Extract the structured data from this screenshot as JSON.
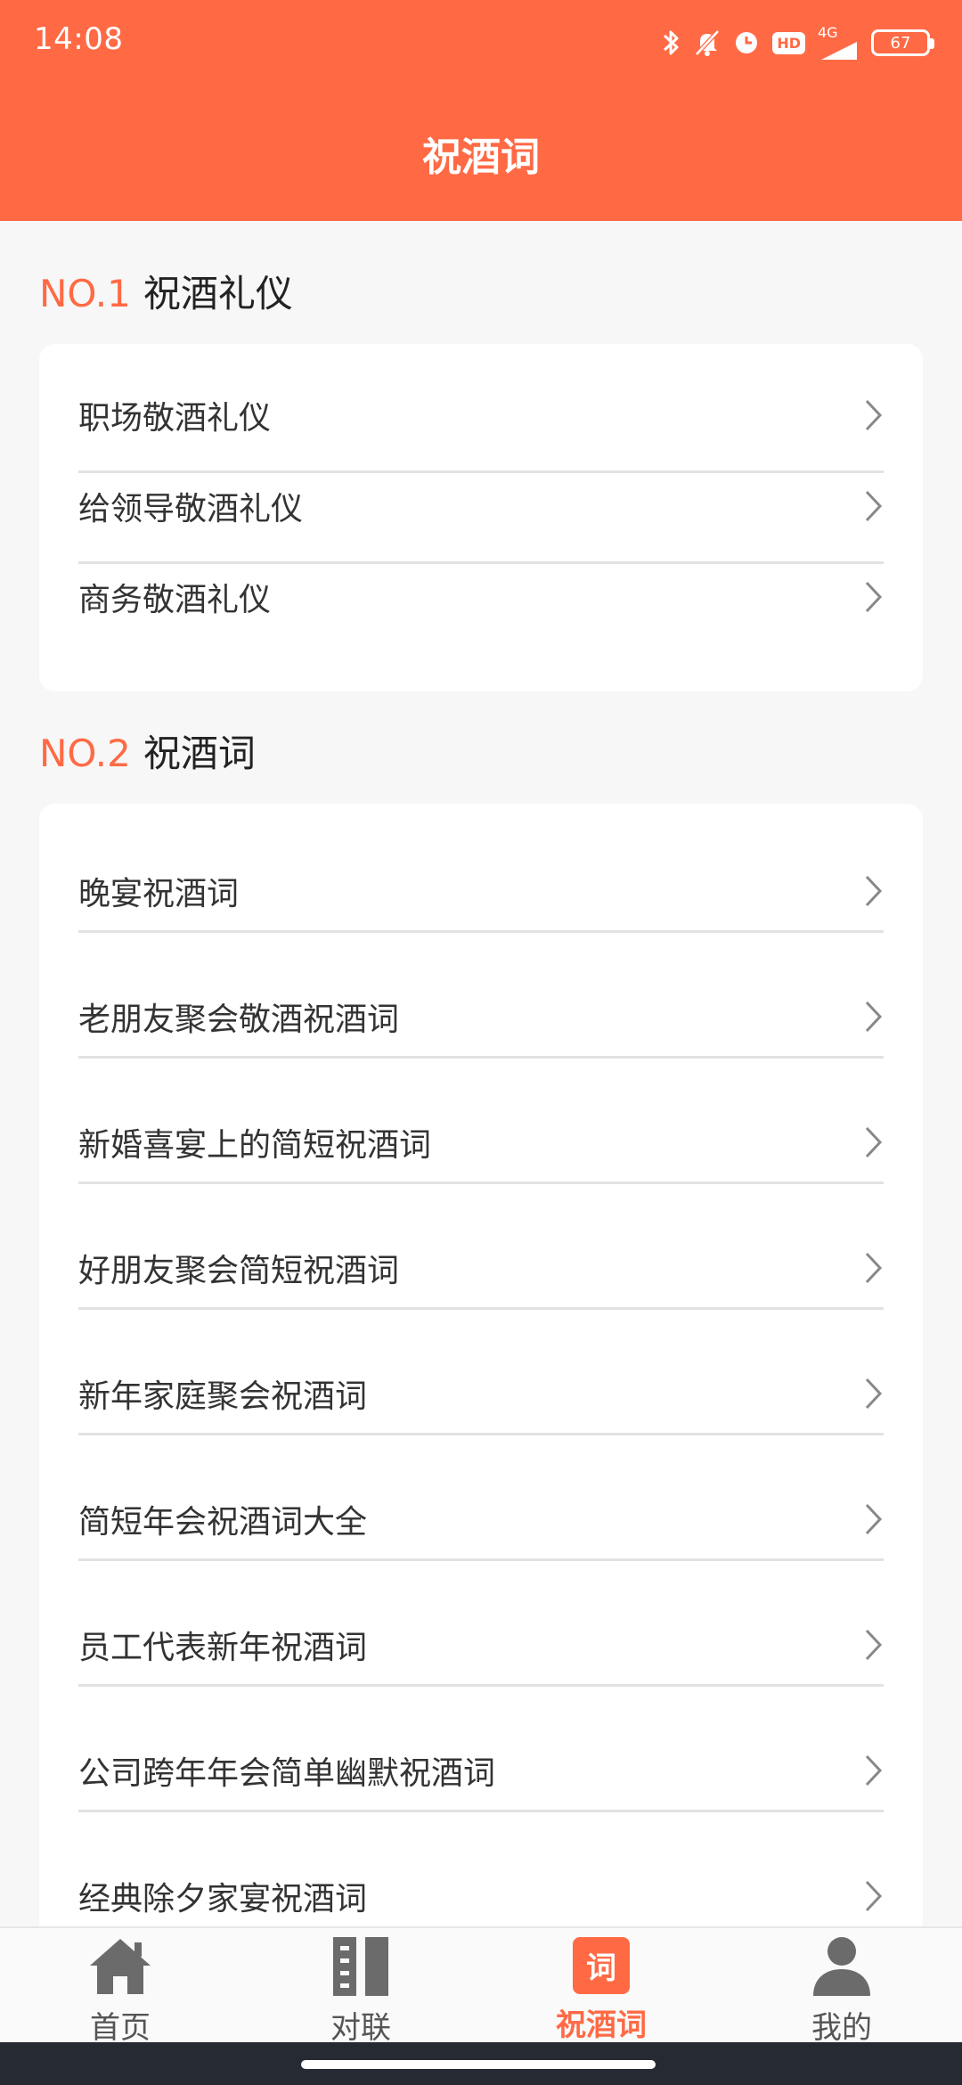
{
  "status_bar": {
    "time": "14:08",
    "network": "4G",
    "hd": "HD",
    "battery": "67"
  },
  "header": {
    "title": "祝酒词"
  },
  "sections": [
    {
      "number": "NO.1",
      "title": "祝酒礼仪",
      "items": [
        "职场敬酒礼仪",
        "给领导敬酒礼仪",
        "商务敬酒礼仪"
      ]
    },
    {
      "number": "NO.2",
      "title": "祝酒词",
      "items": [
        "晚宴祝酒词",
        "老朋友聚会敬酒祝酒词",
        "新婚喜宴上的简短祝酒词",
        "好朋友聚会简短祝酒词",
        "新年家庭聚会祝酒词",
        "简短年会祝酒词大全",
        "员工代表新年祝酒词",
        "公司跨年年会简单幽默祝酒词",
        "经典除夕家宴祝酒词"
      ]
    }
  ],
  "tabbar": {
    "tabs": [
      {
        "label": "首页",
        "icon": "home-icon"
      },
      {
        "label": "对联",
        "icon": "couplet-icon"
      },
      {
        "label": "祝酒词",
        "icon": "ci-icon",
        "icon_text": "词",
        "active": true
      },
      {
        "label": "我的",
        "icon": "profile-icon"
      }
    ]
  },
  "colors": {
    "accent": "#ff6a45",
    "background": "#f7f7f7",
    "navbar": "#252a33"
  }
}
